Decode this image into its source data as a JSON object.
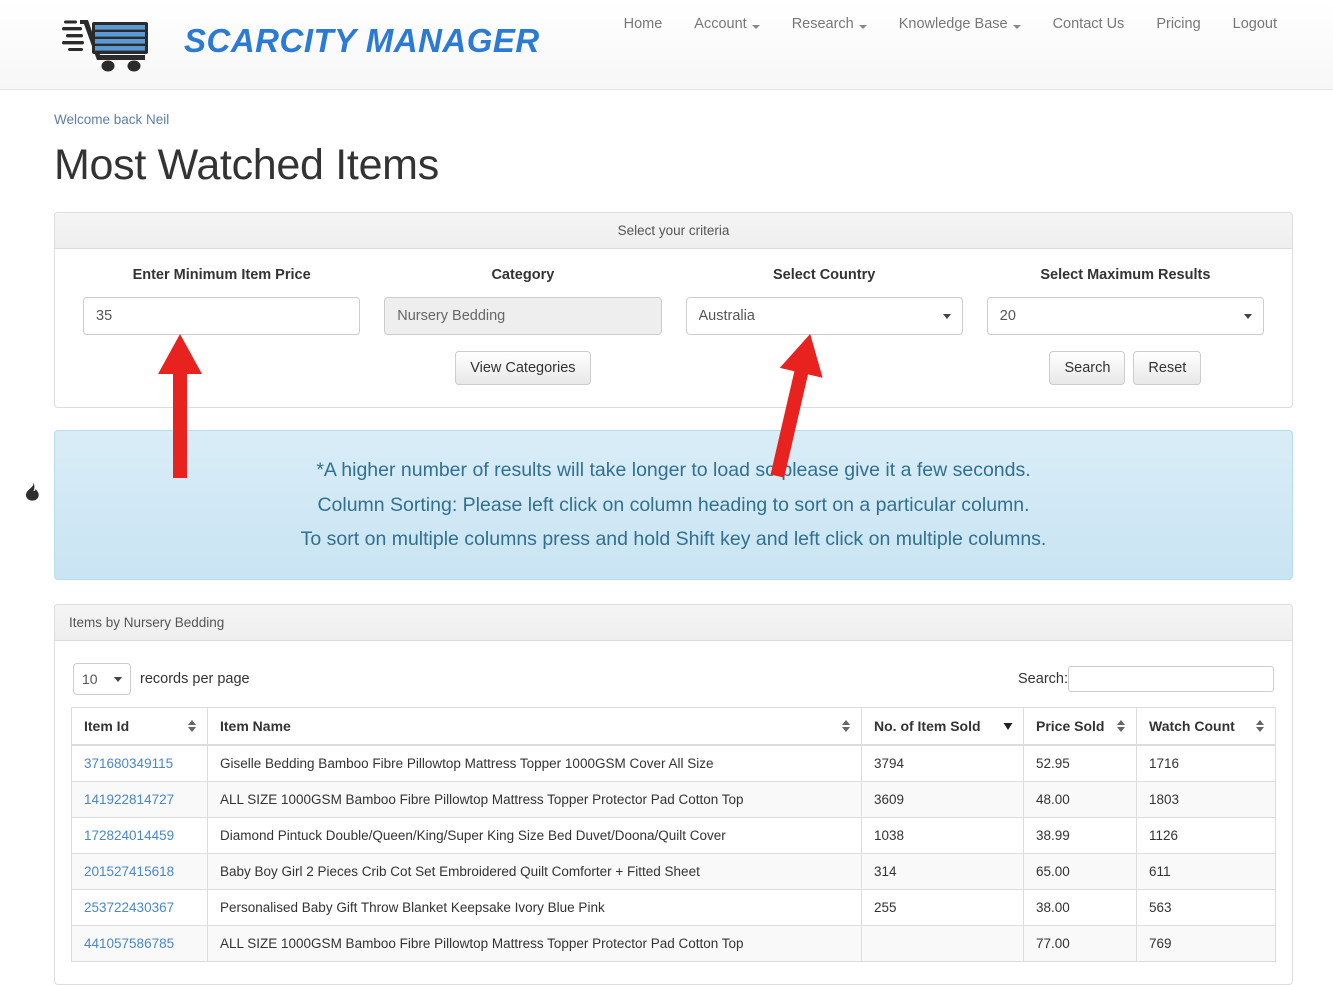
{
  "brand": {
    "name": "SCARCITY MANAGER",
    "color": "#2b7bd4",
    "logo_icon": "shopping-cart-icon"
  },
  "nav": {
    "items": [
      {
        "label": "Home",
        "has_caret": false
      },
      {
        "label": "Account",
        "has_caret": true
      },
      {
        "label": "Research",
        "has_caret": true
      },
      {
        "label": "Knowledge Base",
        "has_caret": true
      },
      {
        "label": "Contact Us",
        "has_caret": false
      },
      {
        "label": "Pricing",
        "has_caret": false
      },
      {
        "label": "Logout",
        "has_caret": false
      }
    ]
  },
  "page": {
    "welcome": "Welcome back Neil",
    "title": "Most Watched Items"
  },
  "criteria": {
    "heading": "Select your criteria",
    "min_price": {
      "label": "Enter Minimum Item Price",
      "value": "35"
    },
    "category": {
      "label": "Category",
      "value": "Nursery Bedding",
      "disabled": true
    },
    "country": {
      "label": "Select Country",
      "value": "Australia"
    },
    "max_results": {
      "label": "Select Maximum Results",
      "value": "20"
    },
    "view_categories_label": "View Categories",
    "search_label": "Search",
    "reset_label": "Reset"
  },
  "notice": {
    "line1": "*A higher number of results will take longer to load so please give it a few seconds.",
    "line2": "Column Sorting: Please left click on column heading to sort on a particular column.",
    "line3": "To sort on multiple columns press and hold Shift key and left click on multiple columns.",
    "bg_color": "#d9edf7",
    "text_color": "#31708f"
  },
  "results": {
    "heading": "Items by Nursery Bedding",
    "page_length": "10",
    "page_length_suffix": "records per page",
    "search_label": "Search:",
    "search_value": "",
    "columns": [
      {
        "label": "Item Id",
        "sort": "none"
      },
      {
        "label": "Item Name",
        "sort": "none"
      },
      {
        "label": "No. of Item Sold",
        "sort": "desc"
      },
      {
        "label": "Price Sold",
        "sort": "none"
      },
      {
        "label": "Watch Count",
        "sort": "none"
      }
    ],
    "rows": [
      {
        "item_id": "371680349115",
        "item_name": "Giselle Bedding Bamboo Fibre Pillowtop Mattress Topper 1000GSM Cover All Size",
        "sold": "3794",
        "price": "52.95",
        "watch": "1716"
      },
      {
        "item_id": "141922814727",
        "item_name": "ALL SIZE 1000GSM Bamboo Fibre Pillowtop Mattress Topper Protector Pad Cotton Top",
        "sold": "3609",
        "price": "48.00",
        "watch": "1803"
      },
      {
        "item_id": "172824014459",
        "item_name": "Diamond Pintuck Double/Queen/King/Super King Size Bed Duvet/Doona/Quilt Cover",
        "sold": "1038",
        "price": "38.99",
        "watch": "1126"
      },
      {
        "item_id": "201527415618",
        "item_name": "Baby Boy Girl 2 Pieces Crib Cot Set Embroidered Quilt Comforter + Fitted Sheet",
        "sold": "314",
        "price": "65.00",
        "watch": "611"
      },
      {
        "item_id": "253722430367",
        "item_name": "Personalised Baby Gift Throw Blanket Keepsake Ivory Blue Pink",
        "sold": "255",
        "price": "38.00",
        "watch": "563"
      },
      {
        "item_id": "441057586785",
        "item_name": "ALL SIZE 1000GSM Bamboo Fibre Pillowtop Mattress Topper Protector Pad Cotton Top",
        "sold": "",
        "price": "77.00",
        "watch": "769"
      }
    ]
  },
  "side_widget": {
    "icon": "flame-icon",
    "glyph": "ὒ5"
  },
  "annotations": {
    "arrow_color": "#e8231f",
    "arrows": [
      {
        "target": "min-price-field"
      },
      {
        "target": "country-select"
      }
    ]
  }
}
